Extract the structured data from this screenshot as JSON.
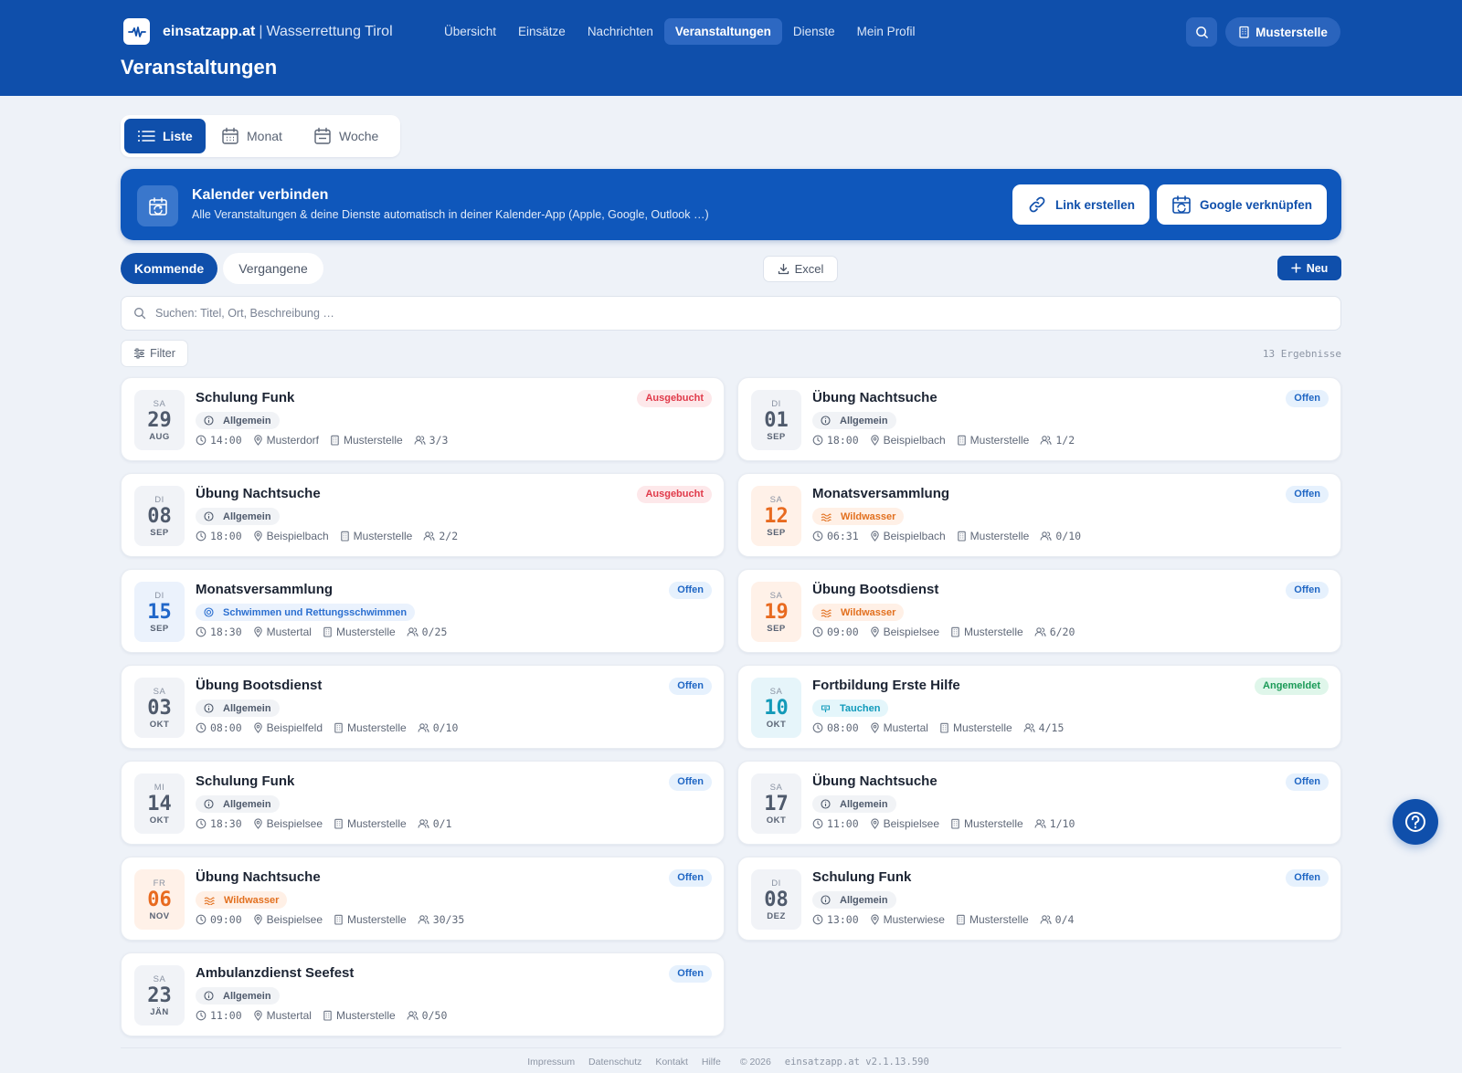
{
  "header": {
    "brand_name": "einsatzapp.at",
    "brand_sep": "|",
    "brand_org": "Wasserrettung Tirol",
    "nav": [
      {
        "label": "Übersicht",
        "active": false
      },
      {
        "label": "Einsätze",
        "active": false
      },
      {
        "label": "Nachrichten",
        "active": false
      },
      {
        "label": "Veranstaltungen",
        "active": true
      },
      {
        "label": "Dienste",
        "active": false
      },
      {
        "label": "Mein Profil",
        "active": false
      }
    ],
    "unit_label": "Musterstelle",
    "page_title": "Veranstaltungen"
  },
  "views": {
    "list": "Liste",
    "month": "Monat",
    "week": "Woche",
    "active": "Liste"
  },
  "banner": {
    "title": "Kalender verbinden",
    "subtitle": "Alle Veranstaltungen & deine Dienste automatisch in deiner Kalender-App (Apple, Google, Outlook …)",
    "link_button": "Link erstellen",
    "google_button": "Google verknüpfen"
  },
  "toolbar": {
    "upcoming": "Kommende",
    "past": "Vergangene",
    "excel": "Excel",
    "new": "Neu",
    "search_placeholder": "Suchen: Titel, Ort, Beschreibung …",
    "search_value": "",
    "filter": "Filter",
    "results": "13 Ergebnisse"
  },
  "events": [
    {
      "weekday": "SA",
      "day": "29",
      "month": "AUG",
      "title": "Schulung Funk",
      "category": "Allgemein",
      "cat_style": "grey",
      "time": "14:00",
      "place": "Musterdorf",
      "unit": "Musterstelle",
      "capacity": "3/3",
      "status": "Ausgebucht",
      "status_style": "full",
      "date_style": "grey"
    },
    {
      "weekday": "DI",
      "day": "01",
      "month": "SEP",
      "title": "Übung Nachtsuche",
      "category": "Allgemein",
      "cat_style": "grey",
      "time": "18:00",
      "place": "Beispielbach",
      "unit": "Musterstelle",
      "capacity": "1/2",
      "status": "Offen",
      "status_style": "open",
      "date_style": "grey"
    },
    {
      "weekday": "DI",
      "day": "08",
      "month": "SEP",
      "title": "Übung Nachtsuche",
      "category": "Allgemein",
      "cat_style": "grey",
      "time": "18:00",
      "place": "Beispielbach",
      "unit": "Musterstelle",
      "capacity": "2/2",
      "status": "Ausgebucht",
      "status_style": "full",
      "date_style": "grey"
    },
    {
      "weekday": "SA",
      "day": "12",
      "month": "SEP",
      "title": "Monatsversammlung",
      "category": "Wildwasser",
      "cat_style": "orange",
      "time": "06:31",
      "place": "Beispielbach",
      "unit": "Musterstelle",
      "capacity": "0/10",
      "status": "Offen",
      "status_style": "open",
      "date_style": "orange"
    },
    {
      "weekday": "DI",
      "day": "15",
      "month": "SEP",
      "title": "Monatsversammlung",
      "category": "Schwimmen und Rettungsschwimmen",
      "cat_style": "blue",
      "time": "18:30",
      "place": "Mustertal",
      "unit": "Musterstelle",
      "capacity": "0/25",
      "status": "Offen",
      "status_style": "open",
      "date_style": "blue"
    },
    {
      "weekday": "SA",
      "day": "19",
      "month": "SEP",
      "title": "Übung Bootsdienst",
      "category": "Wildwasser",
      "cat_style": "orange",
      "time": "09:00",
      "place": "Beispielsee",
      "unit": "Musterstelle",
      "capacity": "6/20",
      "status": "Offen",
      "status_style": "open",
      "date_style": "orange"
    },
    {
      "weekday": "SA",
      "day": "03",
      "month": "OKT",
      "title": "Übung Bootsdienst",
      "category": "Allgemein",
      "cat_style": "grey",
      "time": "08:00",
      "place": "Beispielfeld",
      "unit": "Musterstelle",
      "capacity": "0/10",
      "status": "Offen",
      "status_style": "open",
      "date_style": "grey"
    },
    {
      "weekday": "SA",
      "day": "10",
      "month": "OKT",
      "title": "Fortbildung Erste Hilfe",
      "category": "Tauchen",
      "cat_style": "teal",
      "time": "08:00",
      "place": "Mustertal",
      "unit": "Musterstelle",
      "capacity": "4/15",
      "status": "Angemeldet",
      "status_style": "reg",
      "date_style": "teal"
    },
    {
      "weekday": "MI",
      "day": "14",
      "month": "OKT",
      "title": "Schulung Funk",
      "category": "Allgemein",
      "cat_style": "grey",
      "time": "18:30",
      "place": "Beispielsee",
      "unit": "Musterstelle",
      "capacity": "0/1",
      "status": "Offen",
      "status_style": "open",
      "date_style": "grey"
    },
    {
      "weekday": "SA",
      "day": "17",
      "month": "OKT",
      "title": "Übung Nachtsuche",
      "category": "Allgemein",
      "cat_style": "grey",
      "time": "11:00",
      "place": "Beispielsee",
      "unit": "Musterstelle",
      "capacity": "1/10",
      "status": "Offen",
      "status_style": "open",
      "date_style": "grey"
    },
    {
      "weekday": "FR",
      "day": "06",
      "month": "NOV",
      "title": "Übung Nachtsuche",
      "category": "Wildwasser",
      "cat_style": "orange",
      "time": "09:00",
      "place": "Beispielsee",
      "unit": "Musterstelle",
      "capacity": "30/35",
      "status": "Offen",
      "status_style": "open",
      "date_style": "orange"
    },
    {
      "weekday": "DI",
      "day": "08",
      "month": "DEZ",
      "title": "Schulung Funk",
      "category": "Allgemein",
      "cat_style": "grey",
      "time": "13:00",
      "place": "Musterwiese",
      "unit": "Musterstelle",
      "capacity": "0/4",
      "status": "Offen",
      "status_style": "open",
      "date_style": "grey"
    },
    {
      "weekday": "SA",
      "day": "23",
      "month": "JÄN",
      "title": "Ambulanzdienst Seefest",
      "category": "Allgemein",
      "cat_style": "grey",
      "time": "11:00",
      "place": "Mustertal",
      "unit": "Musterstelle",
      "capacity": "0/50",
      "status": "Offen",
      "status_style": "open",
      "date_style": "grey"
    }
  ],
  "footer": {
    "links": [
      "Impressum",
      "Datenschutz",
      "Kontakt",
      "Hilfe"
    ],
    "copyright": "© 2026",
    "version": "einsatzapp.at v2.1.13.590"
  },
  "colors": {
    "primary": "#0f4fab",
    "background": "#eef2f8",
    "status_full": "#e03a4a",
    "status_open": "#1f66c4",
    "status_registered": "#1a9a57",
    "category_orange": "#e86a1f",
    "category_blue": "#2167c9",
    "category_teal": "#139ab8"
  },
  "icons": {
    "logo": "pulse-wave-icon",
    "search": "search-icon",
    "unit": "building-icon",
    "list": "list-icon",
    "calendar": "calendar-icon",
    "sync": "calendar-sync-icon",
    "link": "link-icon",
    "download": "download-icon",
    "plus": "plus-icon",
    "filter": "sliders-icon",
    "clock": "clock-icon",
    "pin": "map-pin-icon",
    "people": "users-icon",
    "help": "help-circle-icon"
  }
}
